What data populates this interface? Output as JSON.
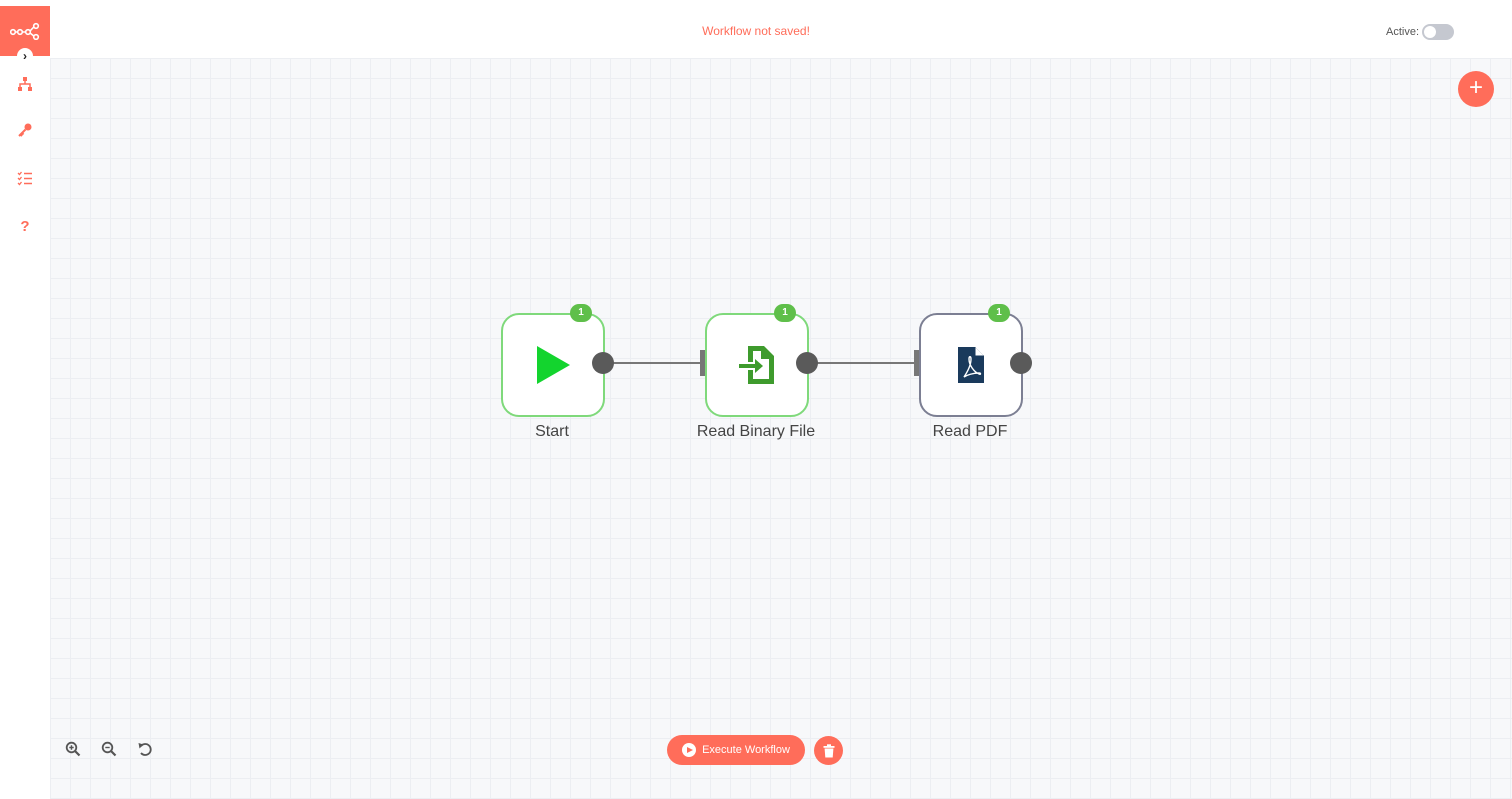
{
  "header": {
    "save_status": "Workflow not saved!",
    "active_label": "Active:"
  },
  "sidebar": {
    "items": [
      {
        "name": "workflows",
        "icon": "sitemap-icon"
      },
      {
        "name": "credentials",
        "icon": "key-icon"
      },
      {
        "name": "executions",
        "icon": "tasks-icon"
      },
      {
        "name": "help",
        "icon": "question-icon"
      }
    ]
  },
  "nodes": [
    {
      "label": "Start",
      "badge": "1",
      "icon": "play-icon",
      "status": "success"
    },
    {
      "label": "Read Binary File",
      "badge": "1",
      "icon": "file-import-icon",
      "status": "success"
    },
    {
      "label": "Read PDF",
      "badge": "1",
      "icon": "file-pdf-icon",
      "status": "default"
    }
  ],
  "footer": {
    "execute_label": "Execute Workflow"
  },
  "colors": {
    "accent": "#ff6d5a",
    "success": "#5fbf4a",
    "start_icon": "#13d42e",
    "read_binary_icon": "#3e9b2d",
    "pdf_icon": "#1a3a5c"
  }
}
